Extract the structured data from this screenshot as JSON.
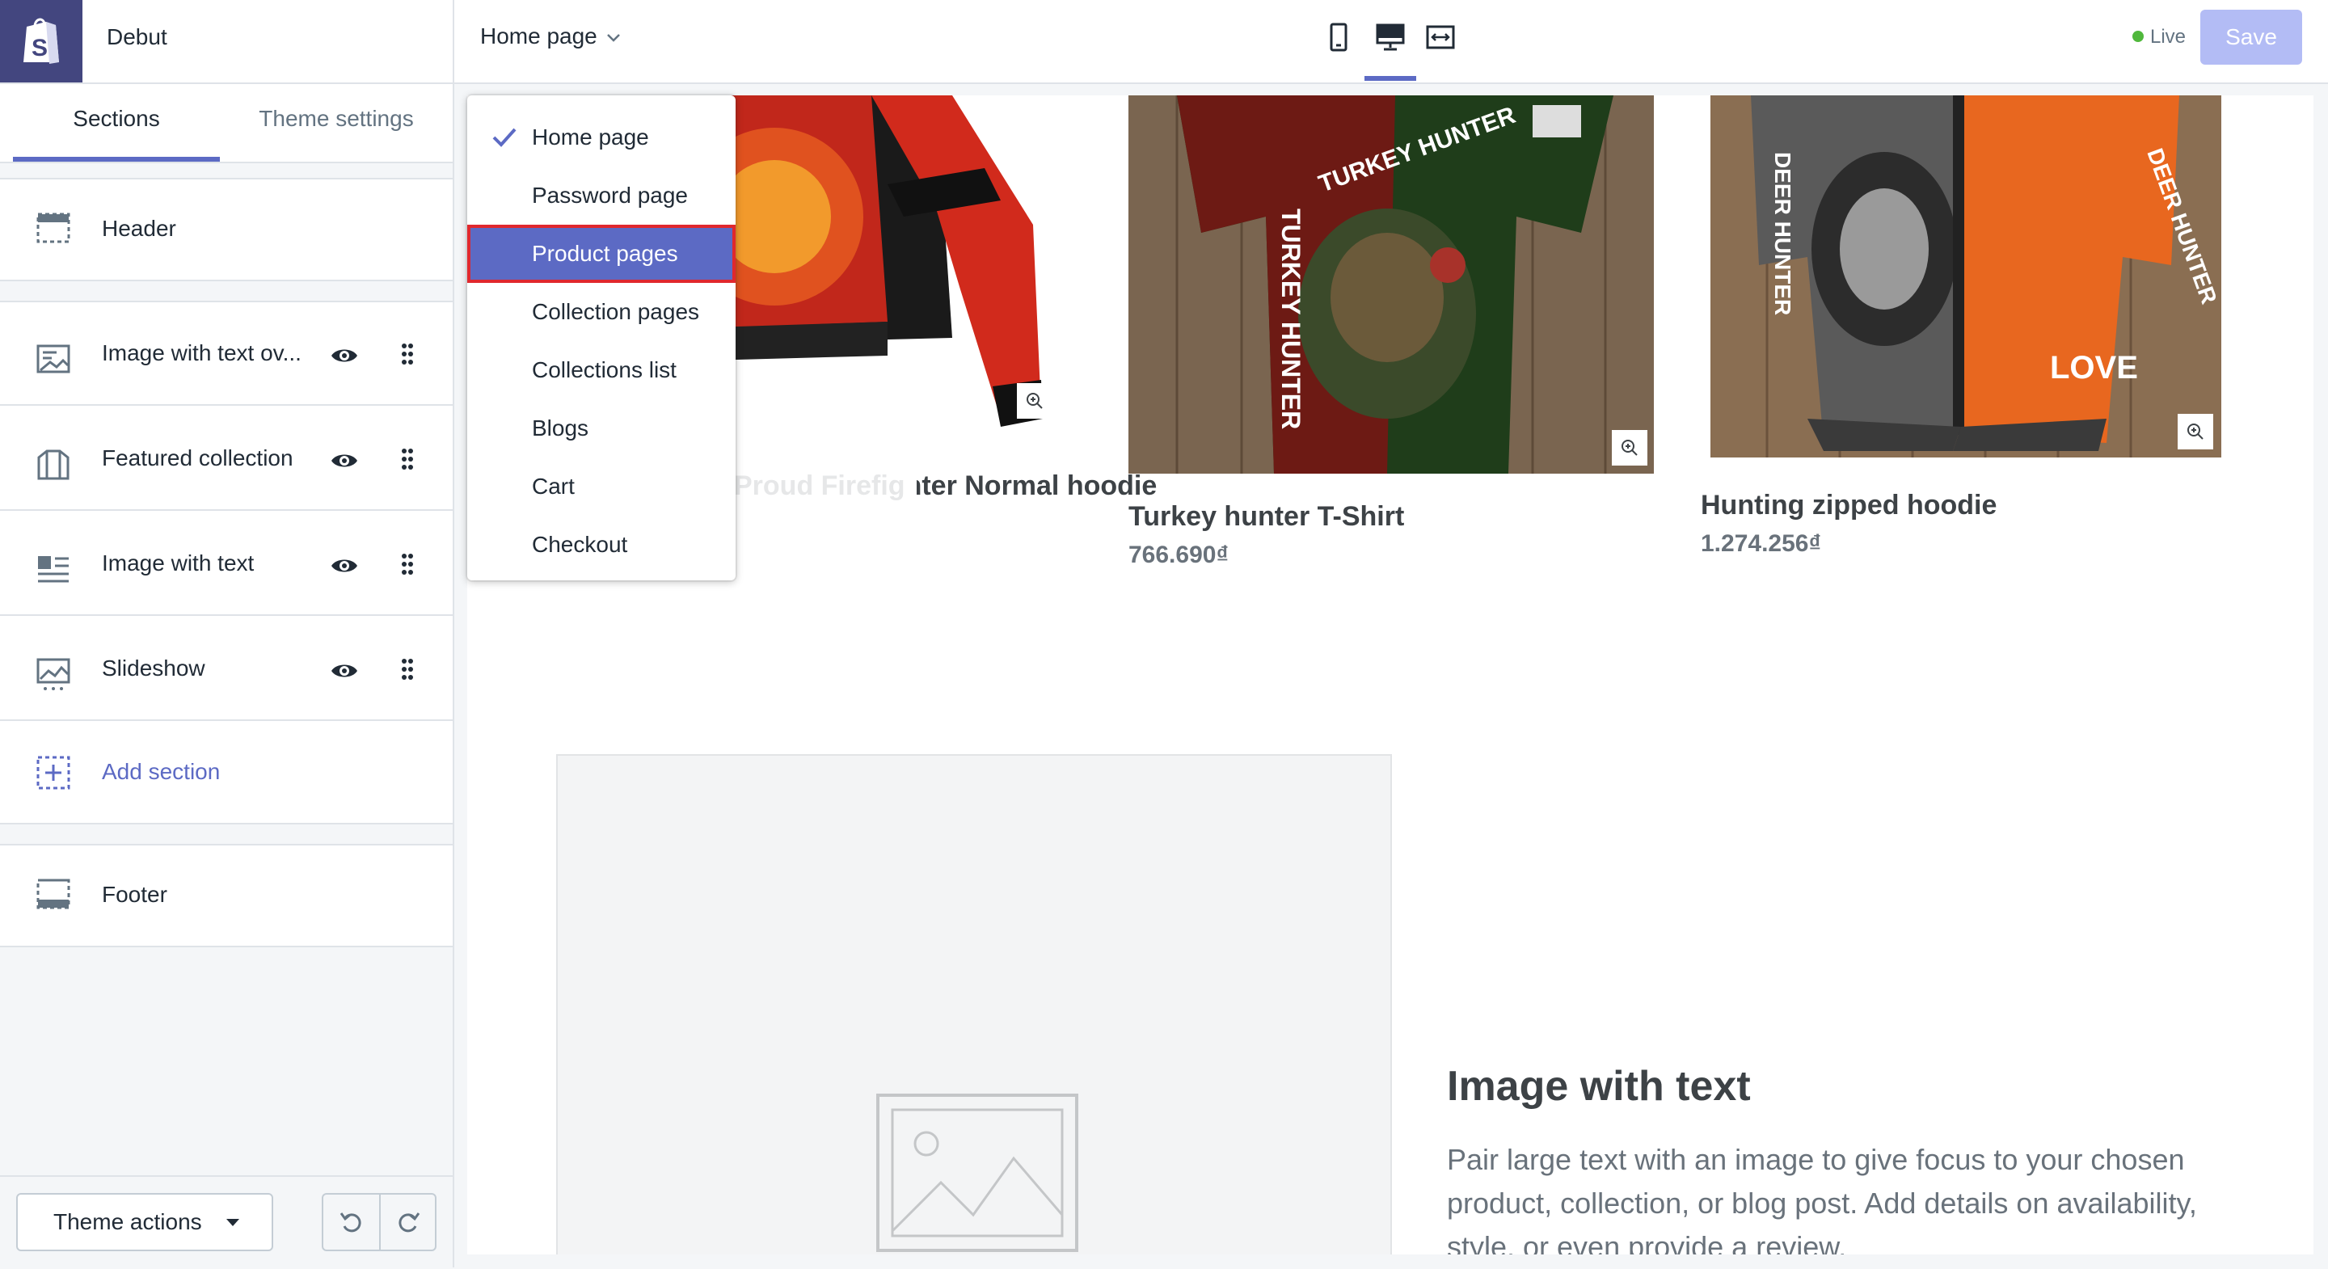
{
  "sidebar": {
    "theme_name": "Debut",
    "tabs": [
      {
        "label": "Sections",
        "active": true
      },
      {
        "label": "Theme settings",
        "active": false
      }
    ],
    "header_section": {
      "label": "Header",
      "icon": "header-layout-icon"
    },
    "sections": [
      {
        "label": "Image with text ov...",
        "icon": "image-text-overlay-icon"
      },
      {
        "label": "Featured collection",
        "icon": "featured-collection-icon"
      },
      {
        "label": "Image with text",
        "icon": "image-with-text-icon"
      },
      {
        "label": "Slideshow",
        "icon": "slideshow-icon"
      }
    ],
    "add_section": {
      "label": "Add section",
      "icon": "add-section-icon"
    },
    "footer_section": {
      "label": "Footer",
      "icon": "footer-layout-icon"
    },
    "theme_actions": "Theme actions"
  },
  "topbar": {
    "page_selector": "Home page",
    "devices": [
      "mobile-view-icon",
      "desktop-view-icon",
      "fullscreen-view-icon"
    ],
    "active_device": "desktop-view-icon",
    "status": "Live",
    "save_label": "Save"
  },
  "dropdown": {
    "items": [
      {
        "label": "Home page",
        "checked": true
      },
      {
        "label": "Password page"
      },
      {
        "label": "Product pages",
        "highlighted": true
      },
      {
        "label": "Collection pages"
      },
      {
        "label": "Collections list"
      },
      {
        "label": "Blogs"
      },
      {
        "label": "Cart"
      },
      {
        "label": "Checkout"
      }
    ]
  },
  "preview": {
    "products": [
      {
        "title": "Proud Firefighter Normal hoodie",
        "visible_title": "nter Normal hoodie"
      },
      {
        "title": "Turkey hunter T-Shirt",
        "price": "766.690₫"
      },
      {
        "title": "Hunting zipped hoodie",
        "price": "1.274.256₫"
      }
    ],
    "image_with_text": {
      "heading": "Image with text",
      "body": "Pair large text with an image to give focus to your chosen product, collection, or blog post. Add details on availability, style, or even provide a review."
    }
  },
  "colors": {
    "accent": "#5c6ac4",
    "logo_bg": "#43467f",
    "live_green": "#50b83c",
    "save_disabled": "#b3bcf5",
    "highlight_outline": "#e0282e"
  }
}
